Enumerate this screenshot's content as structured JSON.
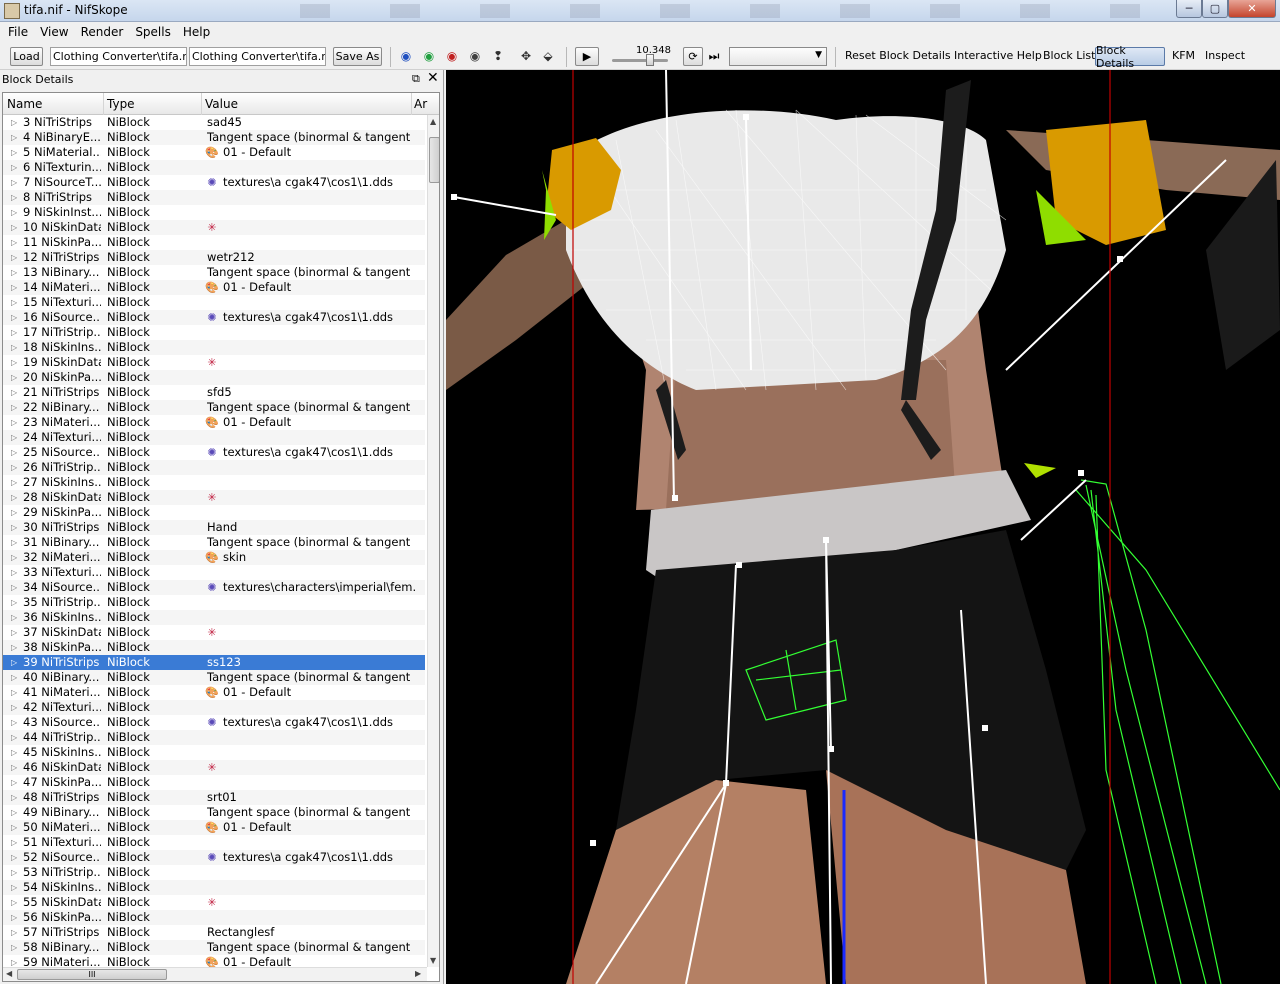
{
  "window": {
    "title": "tifa.nif - NifSkope",
    "minimize": "─",
    "maximize": "▢",
    "close": "✕"
  },
  "menu": [
    "File",
    "View",
    "Render",
    "Spells",
    "Help"
  ],
  "toolbar": {
    "load_label": "Load",
    "path_1": "Clothing Converter\\tifa.nif",
    "path_2": "Clothing Converter\\tifa.nif",
    "save_as_label": "Save As",
    "slider_value": "10.348",
    "reset_block_details": "Reset Block Details",
    "interactive_help": "Interactive Help",
    "block_list": "Block List",
    "block_details": "Block Details",
    "kfm": "KFM",
    "inspect": "Inspect"
  },
  "dock": {
    "title": "Block Details",
    "float_icon": "⧉",
    "close_icon": "✕",
    "columns": [
      "Name",
      "Type",
      "Value",
      "Ar"
    ],
    "selected_row": 39,
    "rows": [
      {
        "name": "3 NiTriStrips",
        "type": "NiBlock",
        "icon": "",
        "value": "sad45"
      },
      {
        "name": "4 NiBinaryE...",
        "type": "NiBlock",
        "icon": "",
        "value": "Tangent space (binormal & tangent ..."
      },
      {
        "name": "5 NiMaterial...",
        "type": "NiBlock",
        "icon": "palette-icon",
        "value": "01 - Default"
      },
      {
        "name": "6 NiTexturin...",
        "type": "NiBlock",
        "icon": "",
        "value": ""
      },
      {
        "name": "7 NiSourceT...",
        "type": "NiBlock",
        "icon": "texture-icon",
        "value": "textures\\a cgak47\\cos1\\1.dds"
      },
      {
        "name": "8 NiTriStrips",
        "type": "NiBlock",
        "icon": "",
        "value": ""
      },
      {
        "name": "9 NiSkinInst...",
        "type": "NiBlock",
        "icon": "",
        "value": ""
      },
      {
        "name": "10 NiSkinData",
        "type": "NiBlock",
        "icon": "skin-data-icon",
        "value": ""
      },
      {
        "name": "11 NiSkinPa...",
        "type": "NiBlock",
        "icon": "",
        "value": ""
      },
      {
        "name": "12 NiTriStrips",
        "type": "NiBlock",
        "icon": "",
        "value": "wetr212"
      },
      {
        "name": "13 NiBinary...",
        "type": "NiBlock",
        "icon": "",
        "value": "Tangent space (binormal & tangent ..."
      },
      {
        "name": "14 NiMateri...",
        "type": "NiBlock",
        "icon": "palette-icon",
        "value": "01 - Default"
      },
      {
        "name": "15 NiTexturi...",
        "type": "NiBlock",
        "icon": "",
        "value": ""
      },
      {
        "name": "16 NiSource...",
        "type": "NiBlock",
        "icon": "texture-icon",
        "value": "textures\\a cgak47\\cos1\\1.dds"
      },
      {
        "name": "17 NiTriStrip...",
        "type": "NiBlock",
        "icon": "",
        "value": ""
      },
      {
        "name": "18 NiSkinIns...",
        "type": "NiBlock",
        "icon": "",
        "value": ""
      },
      {
        "name": "19 NiSkinData",
        "type": "NiBlock",
        "icon": "skin-data-icon",
        "value": ""
      },
      {
        "name": "20 NiSkinPa...",
        "type": "NiBlock",
        "icon": "",
        "value": ""
      },
      {
        "name": "21 NiTriStrips",
        "type": "NiBlock",
        "icon": "",
        "value": "sfd5"
      },
      {
        "name": "22 NiBinary...",
        "type": "NiBlock",
        "icon": "",
        "value": "Tangent space (binormal & tangent ..."
      },
      {
        "name": "23 NiMateri...",
        "type": "NiBlock",
        "icon": "palette-icon",
        "value": "01 - Default"
      },
      {
        "name": "24 NiTexturi...",
        "type": "NiBlock",
        "icon": "",
        "value": ""
      },
      {
        "name": "25 NiSource...",
        "type": "NiBlock",
        "icon": "texture-icon",
        "value": "textures\\a cgak47\\cos1\\1.dds"
      },
      {
        "name": "26 NiTriStrip...",
        "type": "NiBlock",
        "icon": "",
        "value": ""
      },
      {
        "name": "27 NiSkinIns...",
        "type": "NiBlock",
        "icon": "",
        "value": ""
      },
      {
        "name": "28 NiSkinData",
        "type": "NiBlock",
        "icon": "skin-data-icon",
        "value": ""
      },
      {
        "name": "29 NiSkinPa...",
        "type": "NiBlock",
        "icon": "",
        "value": ""
      },
      {
        "name": "30 NiTriStrips",
        "type": "NiBlock",
        "icon": "",
        "value": "Hand"
      },
      {
        "name": "31 NiBinary...",
        "type": "NiBlock",
        "icon": "",
        "value": "Tangent space (binormal & tangent ..."
      },
      {
        "name": "32 NiMateri...",
        "type": "NiBlock",
        "icon": "palette-icon",
        "value": "skin"
      },
      {
        "name": "33 NiTexturi...",
        "type": "NiBlock",
        "icon": "",
        "value": ""
      },
      {
        "name": "34 NiSource...",
        "type": "NiBlock",
        "icon": "texture-icon",
        "value": "textures\\characters\\imperial\\fem..."
      },
      {
        "name": "35 NiTriStrip...",
        "type": "NiBlock",
        "icon": "",
        "value": ""
      },
      {
        "name": "36 NiSkinIns...",
        "type": "NiBlock",
        "icon": "",
        "value": ""
      },
      {
        "name": "37 NiSkinData",
        "type": "NiBlock",
        "icon": "skin-data-icon",
        "value": ""
      },
      {
        "name": "38 NiSkinPa...",
        "type": "NiBlock",
        "icon": "",
        "value": ""
      },
      {
        "name": "39 NiTriStrips",
        "type": "NiBlock",
        "icon": "",
        "value": "ss123"
      },
      {
        "name": "40 NiBinary...",
        "type": "NiBlock",
        "icon": "",
        "value": "Tangent space (binormal & tangent ..."
      },
      {
        "name": "41 NiMateri...",
        "type": "NiBlock",
        "icon": "palette-icon",
        "value": "01 - Default"
      },
      {
        "name": "42 NiTexturi...",
        "type": "NiBlock",
        "icon": "",
        "value": ""
      },
      {
        "name": "43 NiSource...",
        "type": "NiBlock",
        "icon": "texture-icon",
        "value": "textures\\a cgak47\\cos1\\1.dds"
      },
      {
        "name": "44 NiTriStrip...",
        "type": "NiBlock",
        "icon": "",
        "value": ""
      },
      {
        "name": "45 NiSkinIns...",
        "type": "NiBlock",
        "icon": "",
        "value": ""
      },
      {
        "name": "46 NiSkinData",
        "type": "NiBlock",
        "icon": "skin-data-icon",
        "value": ""
      },
      {
        "name": "47 NiSkinPa...",
        "type": "NiBlock",
        "icon": "",
        "value": ""
      },
      {
        "name": "48 NiTriStrips",
        "type": "NiBlock",
        "icon": "",
        "value": "srt01"
      },
      {
        "name": "49 NiBinary...",
        "type": "NiBlock",
        "icon": "",
        "value": "Tangent space (binormal & tangent ..."
      },
      {
        "name": "50 NiMateri...",
        "type": "NiBlock",
        "icon": "palette-icon",
        "value": "01 - Default"
      },
      {
        "name": "51 NiTexturi...",
        "type": "NiBlock",
        "icon": "",
        "value": ""
      },
      {
        "name": "52 NiSource...",
        "type": "NiBlock",
        "icon": "texture-icon",
        "value": "textures\\a cgak47\\cos1\\1.dds"
      },
      {
        "name": "53 NiTriStrip...",
        "type": "NiBlock",
        "icon": "",
        "value": ""
      },
      {
        "name": "54 NiSkinIns...",
        "type": "NiBlock",
        "icon": "",
        "value": ""
      },
      {
        "name": "55 NiSkinData",
        "type": "NiBlock",
        "icon": "skin-data-icon",
        "value": ""
      },
      {
        "name": "56 NiSkinPa...",
        "type": "NiBlock",
        "icon": "",
        "value": ""
      },
      {
        "name": "57 NiTriStrips",
        "type": "NiBlock",
        "icon": "",
        "value": "Rectanglesf"
      },
      {
        "name": "58 NiBinary...",
        "type": "NiBlock",
        "icon": "",
        "value": "Tangent space (binormal & tangent ..."
      },
      {
        "name": "59 NiMateri...",
        "type": "NiBlock",
        "icon": "palette-icon",
        "value": "01 - Default"
      }
    ],
    "hscroll_grip": "III"
  },
  "icons": {
    "palette-icon": "🎨",
    "texture-icon": "✺",
    "skin-data-icon": "✳"
  },
  "colors": {
    "selection": "#3a7bd5",
    "viewport_bg": "#000000",
    "bone_lines": "#ffffff",
    "bounds_red": "#c00000",
    "wire_green": "#33ff33"
  }
}
